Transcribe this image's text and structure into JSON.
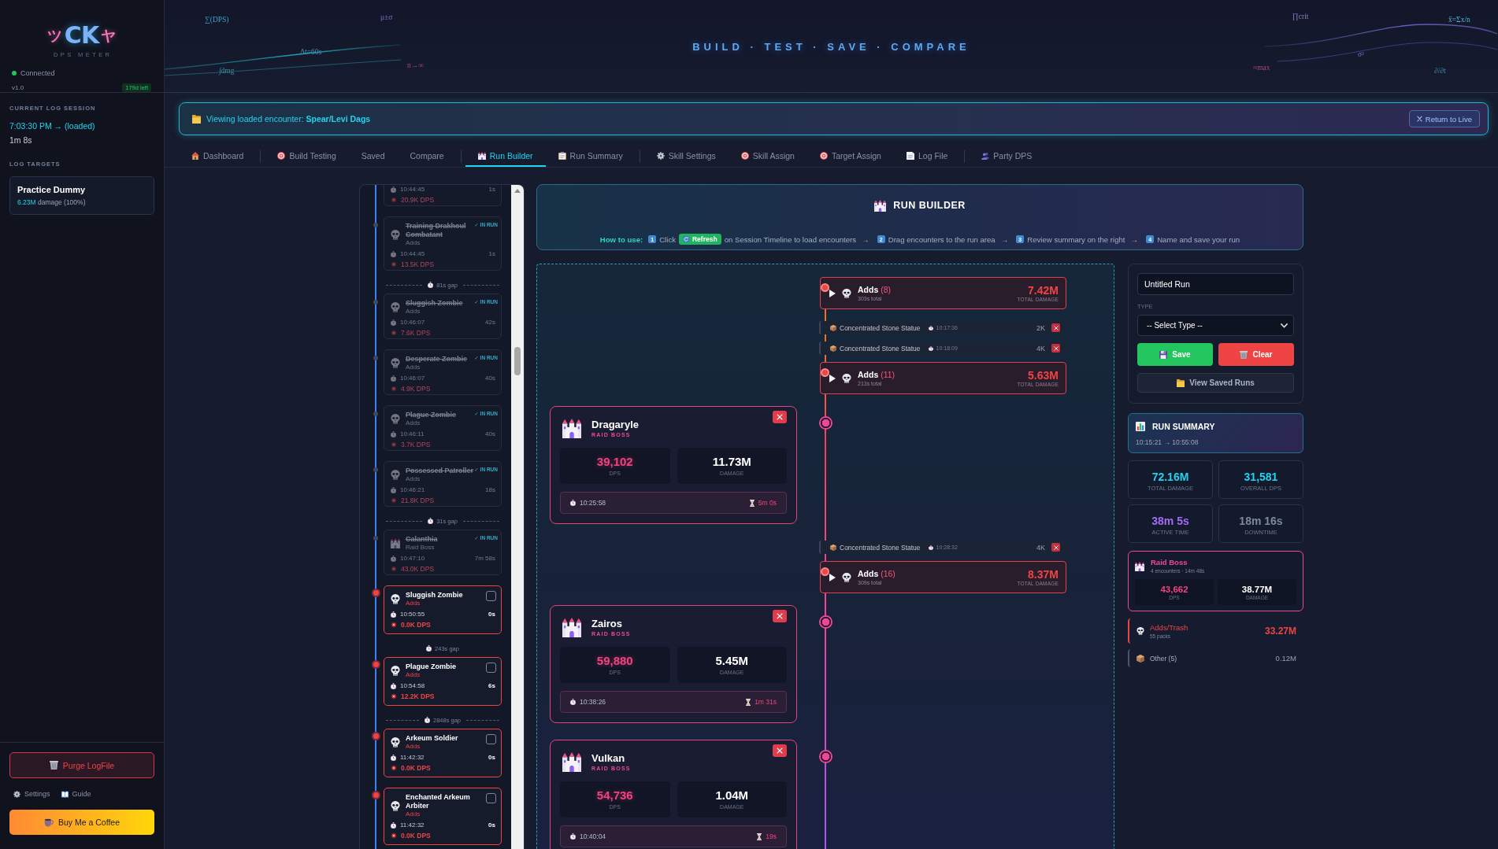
{
  "sidebar": {
    "logo": {
      "left": "ツ",
      "main": "CK",
      "right": "ヤ",
      "subtitle": "DPS METER"
    },
    "connection": {
      "label": "Connected",
      "connected": true
    },
    "version": "v1.0",
    "license": "179d left",
    "session": {
      "heading": "CURRENT LOG SESSION",
      "time": "7:03:30 PM → (loaded)",
      "duration": "1m 8s"
    },
    "targets": {
      "heading": "LOG TARGETS",
      "items": [
        {
          "name": "Practice Dummy",
          "damage": "6.23M",
          "share": "damage (100%)"
        }
      ]
    },
    "purge_button": "Purge LogFile",
    "links": [
      {
        "kind": "settings",
        "label": "Settings"
      },
      {
        "kind": "guide",
        "label": "Guide"
      }
    ],
    "coffee_button": "Buy Me a Coffee"
  },
  "header": {
    "tagline": "BUILD · TEST · SAVE · COMPARE",
    "formulas": [
      "∑(DPS)",
      "μ±σ",
      "Δt=60s",
      "∫dmg",
      "n→∞",
      "∏crit",
      "x̄=Σx/n",
      "σ²",
      "≈max",
      "∂/∂t"
    ]
  },
  "banner": {
    "message": "Viewing loaded encounter: **Spear/Levi Dags**",
    "button": "Return to Live"
  },
  "tab_groups": [
    {
      "tabs": [
        {
          "kind": "home",
          "label": "Dashboard",
          "selected": false
        }
      ]
    },
    {
      "tabs": [
        {
          "kind": "build",
          "label": "Build Testing",
          "selected": false
        },
        {
          "kind": "plain",
          "label": "Saved",
          "selected": false
        },
        {
          "kind": "plain",
          "label": "Compare",
          "selected": false
        }
      ]
    },
    {
      "tabs": [
        {
          "kind": "builder",
          "label": "Run Builder",
          "selected": true
        },
        {
          "kind": "summary",
          "label": "Run Summary",
          "selected": false
        }
      ]
    },
    {
      "tabs": [
        {
          "kind": "settings",
          "label": "Skill Settings",
          "selected": false
        },
        {
          "kind": "skill",
          "label": "Skill Assign",
          "selected": false
        },
        {
          "kind": "target",
          "label": "Target Assign",
          "selected": false
        },
        {
          "kind": "log",
          "label": "Log File",
          "selected": false
        }
      ]
    },
    {
      "tabs": [
        {
          "kind": "party",
          "label": "Party DPS",
          "selected": false
        }
      ]
    }
  ],
  "session_timeline": {
    "items": [
      {
        "kind": "partial",
        "in_run": true,
        "time": "10:44:45",
        "duration": "1s",
        "dps": "20.9K DPS"
      },
      {
        "kind": "adds",
        "in_run": true,
        "name": "Training Drakhoul Combatant",
        "category": "Adds",
        "badge": "✓ IN RUN",
        "time": "10:44:45",
        "duration": "1s",
        "dps": "13.5K DPS"
      },
      {
        "kind": "gap",
        "label": "81s gap",
        "dashed": true
      },
      {
        "kind": "adds",
        "in_run": true,
        "name": "Sluggish Zombie",
        "category": "Adds",
        "badge": "✓ IN RUN",
        "time": "10:46:07",
        "duration": "42s",
        "dps": "7.6K DPS"
      },
      {
        "kind": "adds",
        "in_run": true,
        "name": "Desperate Zombie",
        "category": "Adds",
        "badge": "✓ IN RUN",
        "time": "10:46:07",
        "duration": "40s",
        "dps": "4.9K DPS"
      },
      {
        "kind": "adds",
        "in_run": true,
        "name": "Plague Zombie",
        "category": "Adds",
        "badge": "✓ IN RUN",
        "time": "10:46:11",
        "duration": "40s",
        "dps": "3.7K DPS"
      },
      {
        "kind": "adds",
        "in_run": true,
        "name": "Possessed Patroller",
        "category": "Adds",
        "badge": "✓ IN RUN",
        "time": "10:46:21",
        "duration": "18s",
        "dps": "21.8K DPS"
      },
      {
        "kind": "gap",
        "label": "31s gap",
        "dashed": true
      },
      {
        "kind": "boss",
        "in_run": true,
        "name": "Calanthia",
        "category": "Raid Boss",
        "badge": "✓ IN RUN",
        "time": "10:47:10",
        "duration": "7m 58s",
        "dps": "43.0K DPS"
      },
      {
        "kind": "adds",
        "in_run": false,
        "checked": false,
        "name": "Sluggish Zombie",
        "category": "Adds",
        "time": "10:50:55",
        "duration": "0s",
        "dps": "0.0K DPS"
      },
      {
        "kind": "gap",
        "label": "243s gap",
        "dashed": false
      },
      {
        "kind": "adds",
        "in_run": false,
        "checked": false,
        "name": "Plague Zombie",
        "category": "Adds",
        "time": "10:54:58",
        "duration": "6s",
        "dps": "12.2K DPS"
      },
      {
        "kind": "gap",
        "label": "2848s gap",
        "dashed": true
      },
      {
        "kind": "adds",
        "in_run": false,
        "checked": false,
        "name": "Arkeum Soldier",
        "category": "Adds",
        "time": "11:42:32",
        "duration": "0s",
        "dps": "0.0K DPS"
      },
      {
        "kind": "adds",
        "in_run": false,
        "checked": false,
        "name": "Enchanted Arkeum Arbiter",
        "category": "Adds",
        "time": "11:42:32",
        "duration": "0s",
        "dps": "0.0K DPS"
      }
    ]
  },
  "run_builder": {
    "title": "RUN BUILDER",
    "how_to": {
      "label": "How to use:",
      "steps": [
        {
          "number": "1",
          "text": "Click",
          "button": "Refresh",
          "text_after": "on Session Timeline to load encounters",
          "arrow": "→"
        },
        {
          "number": "2",
          "text": "Drag encounters to the run area",
          "arrow": "→"
        },
        {
          "number": "3",
          "text": "Review summary on the right",
          "arrow": "→"
        },
        {
          "number": "4",
          "text": "Name and save your run"
        }
      ]
    },
    "run_area": {
      "items": [
        {
          "kind": "adds",
          "name": "Adds",
          "count": "(8)",
          "total": "303s total",
          "damage": "7.42M",
          "damage_label": "TOTAL DAMAGE"
        },
        {
          "kind": "statue",
          "name": "Concentrated Stone Statue",
          "time": "10:17:36",
          "damage": "2K"
        },
        {
          "kind": "statue",
          "name": "Concentrated Stone Statue",
          "time": "10:18:09",
          "damage": "4K"
        },
        {
          "kind": "adds",
          "name": "Adds",
          "count": "(11)",
          "total": "213s total",
          "damage": "5.63M",
          "damage_label": "TOTAL DAMAGE"
        },
        {
          "kind": "boss",
          "name": "Dragaryle",
          "role": "RAID BOSS",
          "dps": "39,102",
          "dps_label": "DPS",
          "damage": "11.73M",
          "damage_label": "DAMAGE",
          "time": "10:25:58",
          "duration": "5m 0s"
        },
        {
          "kind": "statue",
          "name": "Concentrated Stone Statue",
          "time": "10:28:32",
          "damage": "4K"
        },
        {
          "kind": "adds",
          "name": "Adds",
          "count": "(16)",
          "total": "309s total",
          "damage": "8.37M",
          "damage_label": "TOTAL DAMAGE"
        },
        {
          "kind": "boss",
          "name": "Zairos",
          "role": "RAID BOSS",
          "dps": "59,880",
          "dps_label": "DPS",
          "damage": "5.45M",
          "damage_label": "DAMAGE",
          "time": "10:38:26",
          "duration": "1m 31s"
        },
        {
          "kind": "boss",
          "name": "Vulkan",
          "role": "RAID BOSS",
          "dps": "54,736",
          "dps_label": "DPS",
          "damage": "1.04M",
          "damage_label": "DAMAGE",
          "time": "10:40:04",
          "duration": "19s"
        }
      ]
    }
  },
  "save_panel": {
    "name_value": "Untitled Run",
    "type_label": "TYPE",
    "type_value": "-- Select Type --",
    "save_button": "Save",
    "clear_button": "Clear",
    "view_button": "View Saved Runs"
  },
  "summary": {
    "title": "RUN SUMMARY",
    "range": "10:15:21 → 10:55:08",
    "stats": [
      {
        "value": "72.16M",
        "label": "TOTAL DAMAGE",
        "color": "#22d3ee"
      },
      {
        "value": "31,581",
        "label": "OVERALL DPS",
        "color": "#22d3ee"
      },
      {
        "value": "38m 5s",
        "label": "ACTIVE TIME",
        "color": "#a36cf5"
      },
      {
        "value": "18m 16s",
        "label": "DOWNTIME",
        "color": "#7e879c"
      }
    ],
    "categories": [
      {
        "kind": "boss",
        "name": "Raid Boss",
        "detail": "4 encounters · 14m 48s",
        "dps": "43,662",
        "dps_label": "DPS",
        "damage": "38.77M",
        "damage_label": "DAMAGE"
      },
      {
        "kind": "adds",
        "name": "Adds/Trash",
        "detail": "55 packs",
        "damage": "33.27M"
      },
      {
        "kind": "other",
        "name": "Other (5)",
        "damage": "0.12M"
      }
    ]
  }
}
